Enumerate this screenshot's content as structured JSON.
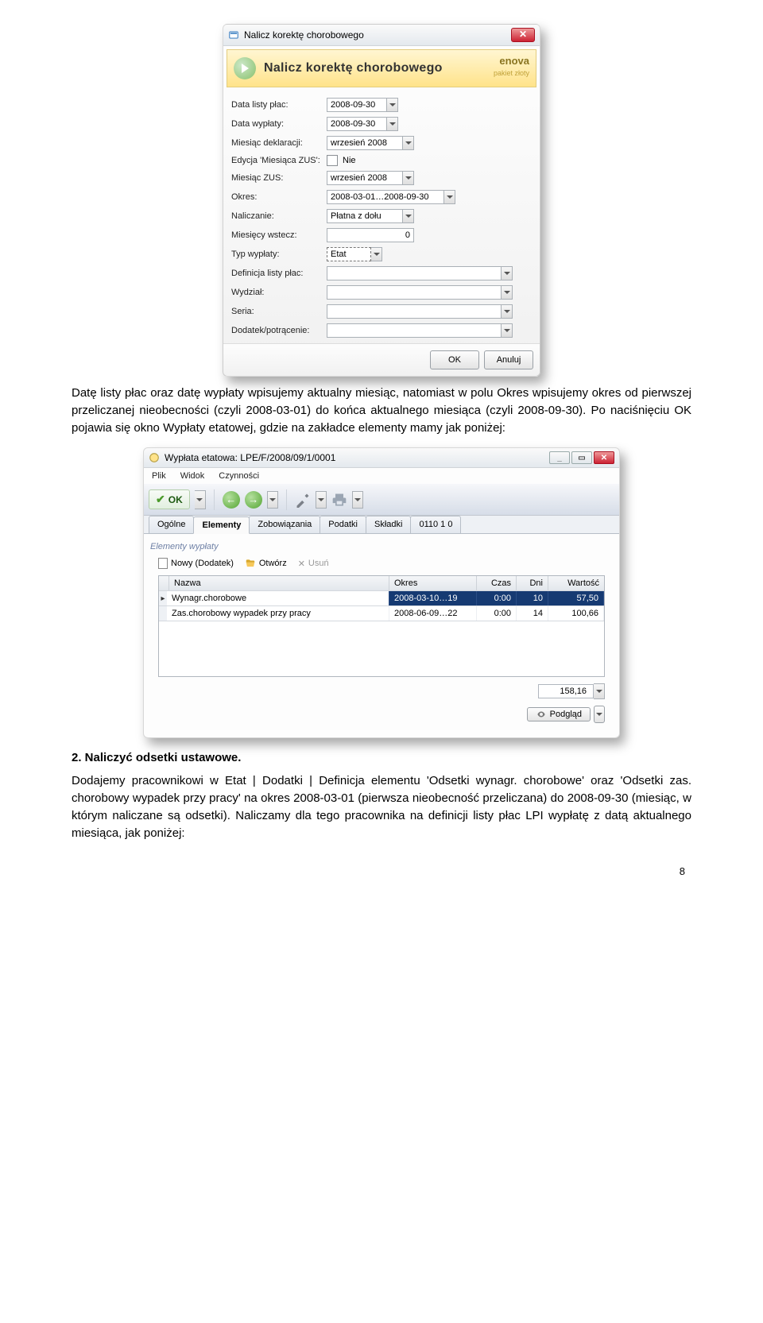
{
  "para1": "Datę listy płac oraz datę wypłaty wpisujemy aktualny miesiąc, natomiast w polu Okres wpisujemy okres od pierwszej przeliczanej nieobecności (czyli 2008-03-01) do końca aktualnego miesiąca (czyli 2008-09-30). Po naciśnięciu OK pojawia się okno Wypłaty etatowej, gdzie na zakładce elementy mamy jak poniżej:",
  "dlg1": {
    "title": "Nalicz korektę chorobowego",
    "headerTitle": "Nalicz korektę chorobowego",
    "brand": "enova",
    "brandSub": "pakiet złoty",
    "fields": {
      "f0": {
        "label": "Data listy płac:",
        "value": "2008-09-30"
      },
      "f1": {
        "label": "Data wypłaty:",
        "value": "2008-09-30"
      },
      "f2": {
        "label": "Miesiąc deklaracji:",
        "value": "wrzesień 2008"
      },
      "f3": {
        "label": "Edycja 'Miesiąca ZUS':",
        "value": "Nie"
      },
      "f4": {
        "label": "Miesiąc ZUS:",
        "value": "wrzesień 2008"
      },
      "f5": {
        "label": "Okres:",
        "value": "2008-03-01…2008-09-30"
      },
      "f6": {
        "label": "Naliczanie:",
        "value": "Płatna z dołu"
      },
      "f7": {
        "label": "Miesięcy wstecz:",
        "value": "0"
      },
      "f8": {
        "label": "Typ wypłaty:",
        "value": "Etat"
      },
      "f9": {
        "label": "Definicja listy płac:",
        "value": ""
      },
      "f10": {
        "label": "Wydział:",
        "value": ""
      },
      "f11": {
        "label": "Seria:",
        "value": ""
      },
      "f12": {
        "label": "Dodatek/potrącenie:",
        "value": ""
      }
    },
    "ok": "OK",
    "cancel": "Anuluj"
  },
  "win2": {
    "title": "Wypłata etatowa: LPE/F/2008/09/1/0001",
    "menu": {
      "m0": "Plik",
      "m1": "Widok",
      "m2": "Czynności"
    },
    "ok": "OK",
    "tabs": {
      "t0": "Ogólne",
      "t1": "Elementy",
      "t2": "Zobowiązania",
      "t3": "Podatki",
      "t4": "Składki",
      "t5": "0110 1 0"
    },
    "panelTitle": "Elementy wypłaty",
    "actions": {
      "a0": "Nowy (Dodatek)",
      "a1": "Otwórz",
      "a2": "Usuń"
    },
    "cols": {
      "c0": "Nazwa",
      "c1": "Okres",
      "c2": "Czas",
      "c3": "Dni",
      "c4": "Wartość"
    },
    "rows": {
      "r0": {
        "nazwa": "Wynagr.chorobowe",
        "okres": "2008-03-10…19",
        "czas": "0:00",
        "dni": "10",
        "wart": "57,50"
      },
      "r1": {
        "nazwa": "Zas.chorobowy wypadek przy pracy",
        "okres": "2008-06-09…22",
        "czas": "0:00",
        "dni": "14",
        "wart": "100,66"
      }
    },
    "total": "158,16",
    "podglad": "Podgląd"
  },
  "heading2": "2.  Naliczyć odsetki ustawowe.",
  "para2": "Dodajemy pracownikowi w Etat | Dodatki | Definicja elementu 'Odsetki wynagr. chorobowe' oraz 'Odsetki zas. chorobowy wypadek przy pracy' na okres 2008-03-01 (pierwsza nieobecność przeliczana) do 2008-09-30 (miesiąc, w którym naliczane są odsetki). Naliczamy dla tego pracownika na definicji listy płac LPI wypłatę z datą aktualnego miesiąca, jak poniżej:",
  "page": "8"
}
